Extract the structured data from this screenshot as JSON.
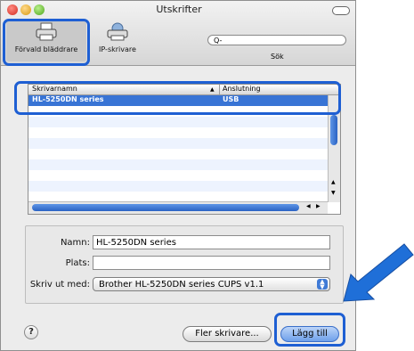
{
  "window": {
    "title": "Utskrifter"
  },
  "toolbar": {
    "default_browser_label": "Förvald bläddrare",
    "ip_printer_label": "IP-skrivare",
    "search_placeholder": "Q-",
    "search_label": "Sök"
  },
  "printer_list": {
    "columns": [
      "Skrivarnamn",
      "Anslutning"
    ],
    "sort_indicator": "▲",
    "rows": [
      {
        "name": "HL-5250DN series",
        "connection": "USB"
      }
    ]
  },
  "form": {
    "name_label": "Namn:",
    "name_value": "HL-5250DN series",
    "location_label": "Plats:",
    "location_value": "",
    "print_with_label": "Skriv ut med:",
    "print_with_value": "Brother HL-5250DN series CUPS v1.1"
  },
  "footer": {
    "help_label": "?",
    "more_printers_label": "Fler skrivare...",
    "add_label": "Lägg till"
  },
  "colors": {
    "highlight": "#1e5fd3",
    "selection": "#3874d5",
    "arrow": "#1f6fd8"
  }
}
